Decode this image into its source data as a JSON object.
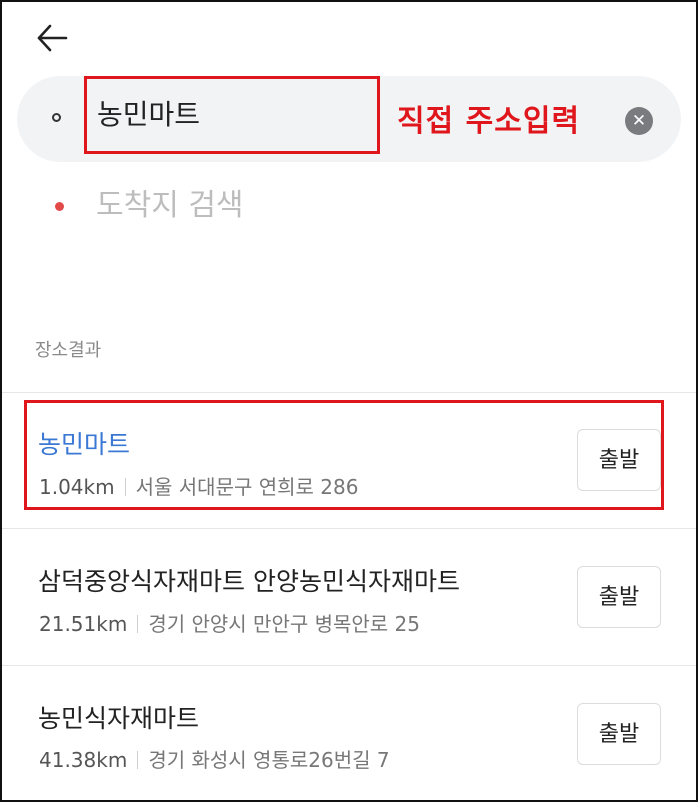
{
  "search": {
    "origin_value": "농민마트",
    "destination_placeholder": "도착지 검색",
    "clear_icon": "close-icon",
    "back_icon": "arrow-left-icon"
  },
  "annotation": {
    "text": "직접 주소입력",
    "color": "#e0161d"
  },
  "section": {
    "label": "장소결과"
  },
  "results": [
    {
      "name": "농민마트",
      "distance": "1.04km",
      "address": "서울 서대문구 연희로 286",
      "button": "출발"
    },
    {
      "name": "삼덕중앙식자재마트 안양농민식자재마트",
      "distance": "21.51km",
      "address": "경기 안양시 만안구 병목안로 25",
      "button": "출발"
    },
    {
      "name": "농민식자재마트",
      "distance": "41.38km",
      "address": "경기 화성시 영통로26번길 7",
      "button": "출발"
    }
  ],
  "colors": {
    "accent_blue": "#3a78d4",
    "annotation_red": "#e0161d",
    "destination_dot": "#e24a4a"
  }
}
